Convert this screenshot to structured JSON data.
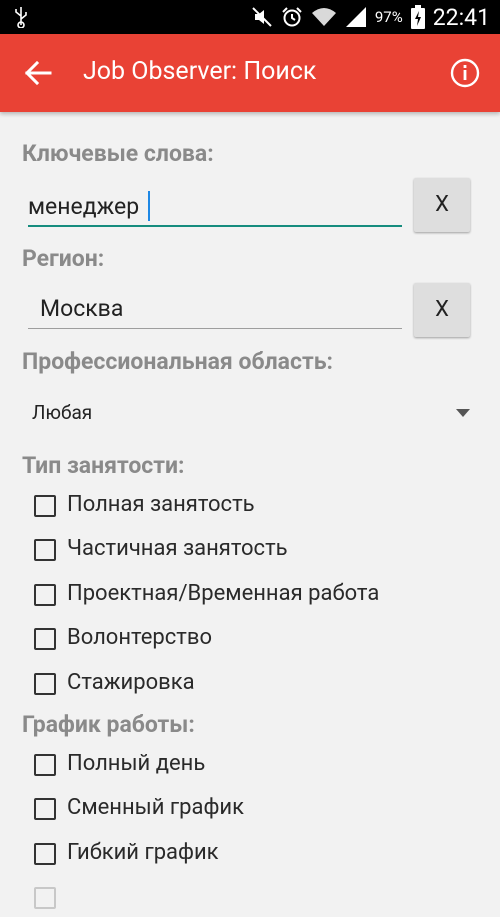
{
  "status_bar": {
    "battery_percent": "97%",
    "time": "22:41",
    "icons": [
      "usb-icon",
      "mute-icon",
      "alarm-icon",
      "wifi-icon",
      "signal-icon",
      "battery-icon"
    ]
  },
  "app_bar": {
    "title": "Job Observer: Поиск",
    "color": "#e94235"
  },
  "keywords": {
    "label": "Ключевые слова:",
    "value": "менеджер",
    "clear_label": "X"
  },
  "region": {
    "label": "Регион:",
    "value": "Москва",
    "clear_label": "X"
  },
  "professional_area": {
    "label": "Профессиональная область:",
    "selected": "Любая"
  },
  "employment_type": {
    "label": "Тип занятости:",
    "options": [
      {
        "label": "Полная занятость",
        "checked": false
      },
      {
        "label": "Частичная занятость",
        "checked": false
      },
      {
        "label": "Проектная/Временная работа",
        "checked": false
      },
      {
        "label": "Волонтерство",
        "checked": false
      },
      {
        "label": "Стажировка",
        "checked": false
      }
    ]
  },
  "schedule": {
    "label": "График работы:",
    "options": [
      {
        "label": "Полный день",
        "checked": false
      },
      {
        "label": "Сменный график",
        "checked": false
      },
      {
        "label": "Гибкий график",
        "checked": false
      }
    ]
  }
}
